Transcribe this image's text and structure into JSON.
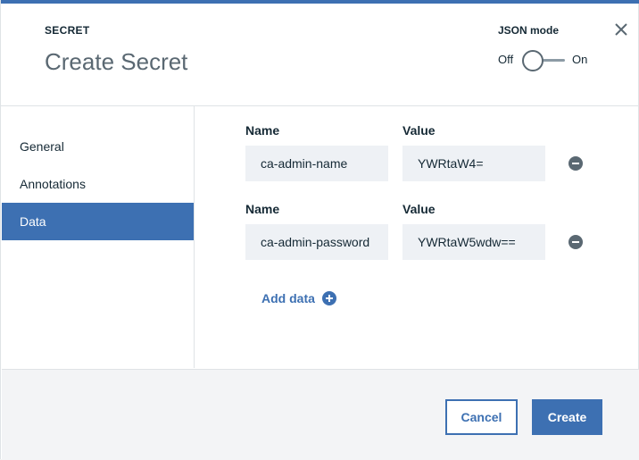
{
  "header": {
    "eyebrow": "SECRET",
    "title": "Create Secret",
    "json_mode": {
      "label": "JSON mode",
      "off_label": "Off",
      "on_label": "On",
      "enabled": false
    },
    "close_icon": "close-icon"
  },
  "sidebar": {
    "items": [
      {
        "label": "General",
        "active": false
      },
      {
        "label": "Annotations",
        "active": false
      },
      {
        "label": "Data",
        "active": true
      }
    ]
  },
  "data_entries": [
    {
      "name_label": "Name",
      "value_label": "Value",
      "name": "ca-admin-name",
      "value": "YWRtaW4="
    },
    {
      "name_label": "Name",
      "value_label": "Value",
      "name": "ca-admin-password",
      "value": "YWRtaW5wdw=="
    }
  ],
  "add_data": {
    "label": "Add data",
    "icon": "plus-circle-icon"
  },
  "footer": {
    "cancel_label": "Cancel",
    "create_label": "Create"
  },
  "colors": {
    "accent": "#3d70b2",
    "field_bg": "#eef1f5",
    "text": "#152935",
    "muted": "#5a6872"
  }
}
